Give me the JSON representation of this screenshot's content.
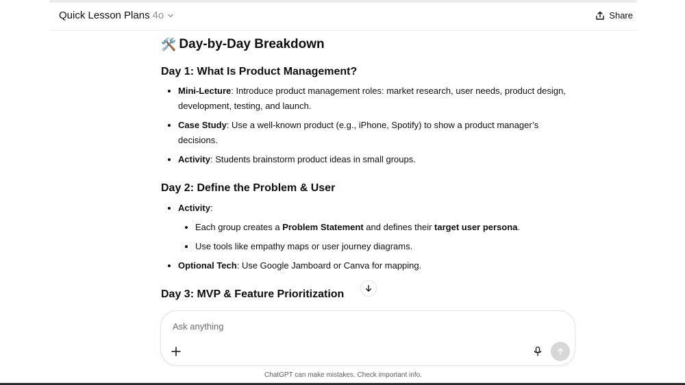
{
  "header": {
    "title": "Quick Lesson Plans",
    "model_version": "4o",
    "share_label": "Share"
  },
  "content": {
    "section_emoji": "🛠️",
    "section_title": "Day-by-Day Breakdown",
    "day1": {
      "heading": "Day 1: What Is Product Management?",
      "items": [
        {
          "label": "Mini-Lecture",
          "text1": ": Introduce product management roles: market research, user needs, product design,",
          "text2": "development, testing, and launch."
        },
        {
          "label": "Case Study",
          "text1": ": Use a well-known product (e.g., iPhone, Spotify) to show a product manager’s",
          "text2": "decisions."
        },
        {
          "label": "Activity",
          "text1": ": Students brainstorm product ideas in small groups."
        }
      ]
    },
    "day2": {
      "heading": "Day 2: Define the Problem & User",
      "activity_label": "Activity",
      "activity_colon": ":",
      "sub1_a": "Each group creates a ",
      "sub1_b": "Problem Statement",
      "sub1_c": " and defines their ",
      "sub1_d": "target user persona",
      "sub1_e": ".",
      "sub2": "Use tools like empathy maps or user journey diagrams.",
      "tech_label": "Optional Tech",
      "tech_text": ": Use Google Jamboard or Canva for mapping."
    },
    "day3": {
      "heading": "Day 3: MVP & Feature Prioritization"
    }
  },
  "composer": {
    "placeholder": "Ask anything"
  },
  "footer": {
    "note": "ChatGPT can make mistakes. Check important info."
  }
}
